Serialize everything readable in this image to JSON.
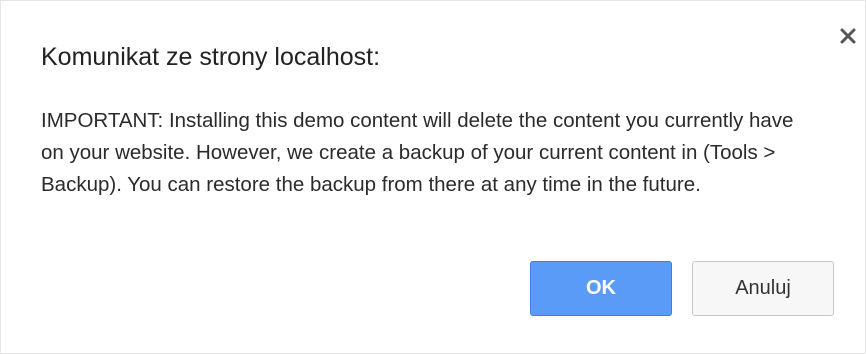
{
  "dialog": {
    "title": "Komunikat ze strony localhost:",
    "message": "IMPORTANT: Installing this demo content will delete the content you currently have on your website. However, we create a backup of your current content in (Tools > Backup). You can restore the backup from there at any time in the future.",
    "close_icon": "close-icon",
    "ok_label": "OK",
    "cancel_label": "Anuluj"
  },
  "colors": {
    "ok_button": "#5b9bf8",
    "cancel_button": "#f7f7f7",
    "background": "#ffffff"
  }
}
